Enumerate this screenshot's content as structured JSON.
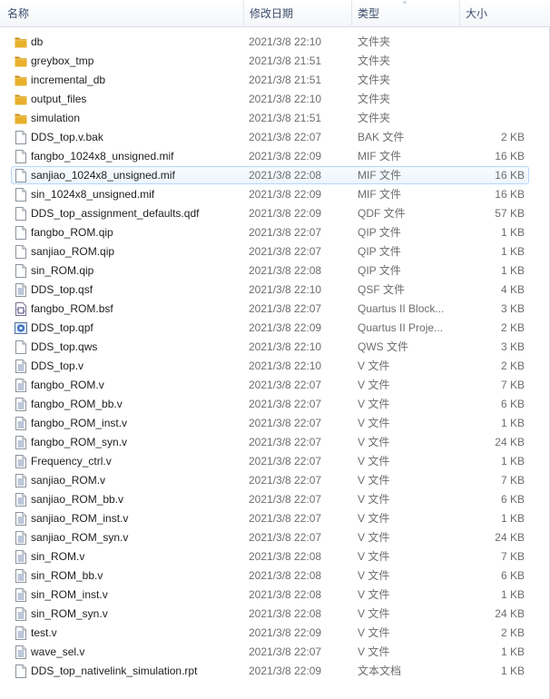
{
  "columns": {
    "name": "名称",
    "date": "修改日期",
    "type": "类型",
    "size": "大小"
  },
  "sort_indicator": "^",
  "colors": {
    "folder": "#e8b02c",
    "folder_dark": "#c98d12",
    "hover_border": "#b8d6fb",
    "header_text": "#3a4c6b"
  },
  "files": [
    {
      "name": "db",
      "date": "2021/3/8 22:10",
      "type": "文件夹",
      "size": "",
      "icon": "folder-icon"
    },
    {
      "name": "greybox_tmp",
      "date": "2021/3/8 21:51",
      "type": "文件夹",
      "size": "",
      "icon": "folder-icon"
    },
    {
      "name": "incremental_db",
      "date": "2021/3/8 21:51",
      "type": "文件夹",
      "size": "",
      "icon": "folder-icon"
    },
    {
      "name": "output_files",
      "date": "2021/3/8 22:10",
      "type": "文件夹",
      "size": "",
      "icon": "folder-icon"
    },
    {
      "name": "simulation",
      "date": "2021/3/8 21:51",
      "type": "文件夹",
      "size": "",
      "icon": "folder-icon"
    },
    {
      "name": "DDS_top.v.bak",
      "date": "2021/3/8 22:07",
      "type": "BAK 文件",
      "size": "2 KB",
      "icon": "file-icon"
    },
    {
      "name": "fangbo_1024x8_unsigned.mif",
      "date": "2021/3/8 22:09",
      "type": "MIF 文件",
      "size": "16 KB",
      "icon": "file-icon"
    },
    {
      "name": "sanjiao_1024x8_unsigned.mif",
      "date": "2021/3/8 22:08",
      "type": "MIF 文件",
      "size": "16 KB",
      "icon": "file-icon",
      "hover": true
    },
    {
      "name": "sin_1024x8_unsigned.mif",
      "date": "2021/3/8 22:09",
      "type": "MIF 文件",
      "size": "16 KB",
      "icon": "file-icon"
    },
    {
      "name": "DDS_top_assignment_defaults.qdf",
      "date": "2021/3/8 22:09",
      "type": "QDF 文件",
      "size": "57 KB",
      "icon": "file-icon"
    },
    {
      "name": "fangbo_ROM.qip",
      "date": "2021/3/8 22:07",
      "type": "QIP 文件",
      "size": "1 KB",
      "icon": "file-icon"
    },
    {
      "name": "sanjiao_ROM.qip",
      "date": "2021/3/8 22:07",
      "type": "QIP 文件",
      "size": "1 KB",
      "icon": "file-icon"
    },
    {
      "name": "sin_ROM.qip",
      "date": "2021/3/8 22:08",
      "type": "QIP 文件",
      "size": "1 KB",
      "icon": "file-icon"
    },
    {
      "name": "DDS_top.qsf",
      "date": "2021/3/8 22:10",
      "type": "QSF 文件",
      "size": "4 KB",
      "icon": "text-file-icon"
    },
    {
      "name": "fangbo_ROM.bsf",
      "date": "2021/3/8 22:07",
      "type": "Quartus II Block...",
      "size": "3 KB",
      "icon": "block-symbol-file-icon"
    },
    {
      "name": "DDS_top.qpf",
      "date": "2021/3/8 22:09",
      "type": "Quartus II Proje...",
      "size": "2 KB",
      "icon": "quartus-project-icon"
    },
    {
      "name": "DDS_top.qws",
      "date": "2021/3/8 22:10",
      "type": "QWS 文件",
      "size": "3 KB",
      "icon": "file-icon"
    },
    {
      "name": "DDS_top.v",
      "date": "2021/3/8 22:10",
      "type": "V 文件",
      "size": "2 KB",
      "icon": "text-file-icon"
    },
    {
      "name": "fangbo_ROM.v",
      "date": "2021/3/8 22:07",
      "type": "V 文件",
      "size": "7 KB",
      "icon": "text-file-icon"
    },
    {
      "name": "fangbo_ROM_bb.v",
      "date": "2021/3/8 22:07",
      "type": "V 文件",
      "size": "6 KB",
      "icon": "text-file-icon"
    },
    {
      "name": "fangbo_ROM_inst.v",
      "date": "2021/3/8 22:07",
      "type": "V 文件",
      "size": "1 KB",
      "icon": "text-file-icon"
    },
    {
      "name": "fangbo_ROM_syn.v",
      "date": "2021/3/8 22:07",
      "type": "V 文件",
      "size": "24 KB",
      "icon": "text-file-icon"
    },
    {
      "name": "Frequency_ctrl.v",
      "date": "2021/3/8 22:07",
      "type": "V 文件",
      "size": "1 KB",
      "icon": "text-file-icon"
    },
    {
      "name": "sanjiao_ROM.v",
      "date": "2021/3/8 22:07",
      "type": "V 文件",
      "size": "7 KB",
      "icon": "text-file-icon"
    },
    {
      "name": "sanjiao_ROM_bb.v",
      "date": "2021/3/8 22:07",
      "type": "V 文件",
      "size": "6 KB",
      "icon": "text-file-icon"
    },
    {
      "name": "sanjiao_ROM_inst.v",
      "date": "2021/3/8 22:07",
      "type": "V 文件",
      "size": "1 KB",
      "icon": "text-file-icon"
    },
    {
      "name": "sanjiao_ROM_syn.v",
      "date": "2021/3/8 22:07",
      "type": "V 文件",
      "size": "24 KB",
      "icon": "text-file-icon"
    },
    {
      "name": "sin_ROM.v",
      "date": "2021/3/8 22:08",
      "type": "V 文件",
      "size": "7 KB",
      "icon": "text-file-icon"
    },
    {
      "name": "sin_ROM_bb.v",
      "date": "2021/3/8 22:08",
      "type": "V 文件",
      "size": "6 KB",
      "icon": "text-file-icon"
    },
    {
      "name": "sin_ROM_inst.v",
      "date": "2021/3/8 22:08",
      "type": "V 文件",
      "size": "1 KB",
      "icon": "text-file-icon"
    },
    {
      "name": "sin_ROM_syn.v",
      "date": "2021/3/8 22:08",
      "type": "V 文件",
      "size": "24 KB",
      "icon": "text-file-icon"
    },
    {
      "name": "test.v",
      "date": "2021/3/8 22:09",
      "type": "V 文件",
      "size": "2 KB",
      "icon": "text-file-icon"
    },
    {
      "name": "wave_sel.v",
      "date": "2021/3/8 22:07",
      "type": "V 文件",
      "size": "1 KB",
      "icon": "text-file-icon"
    },
    {
      "name": "DDS_top_nativelink_simulation.rpt",
      "date": "2021/3/8 22:09",
      "type": "文本文档",
      "size": "1 KB",
      "icon": "file-icon"
    }
  ]
}
